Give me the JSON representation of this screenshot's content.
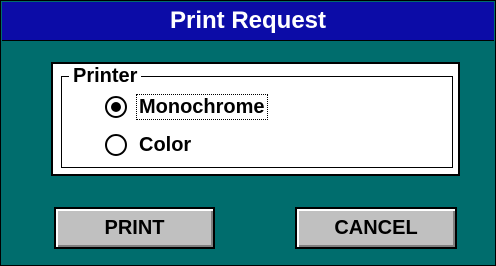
{
  "dialog": {
    "title": "Print Request"
  },
  "printer_group": {
    "legend": "Printer",
    "options": [
      {
        "label": "Monochrome",
        "selected": true,
        "focused": true
      },
      {
        "label": "Color",
        "selected": false,
        "focused": false
      }
    ]
  },
  "buttons": {
    "print_label": "PRINT",
    "cancel_label": "CANCEL"
  },
  "colors": {
    "window_background": "#006d6d",
    "titlebar": "#0c0ca7",
    "button_face": "#c0c0c0"
  }
}
